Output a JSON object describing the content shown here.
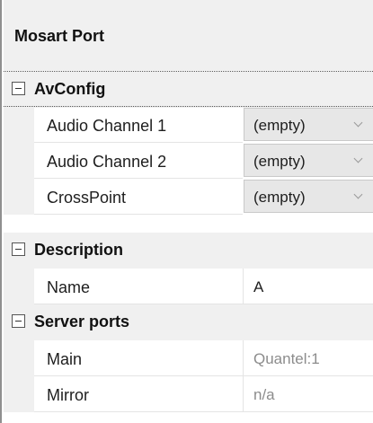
{
  "panel": {
    "title": "Mosart Port"
  },
  "categories": [
    {
      "label": "AvConfig",
      "rows": [
        {
          "name": "Audio Channel 1",
          "value": "(empty)"
        },
        {
          "name": "Audio Channel 2",
          "value": "(empty)"
        },
        {
          "name": "CrossPoint",
          "value": "(empty)"
        }
      ]
    },
    {
      "label": "Description",
      "rows": [
        {
          "name": "Name",
          "value": "A"
        }
      ]
    },
    {
      "label": "Server ports",
      "rows": [
        {
          "name": "Main",
          "value": "Quantel:1"
        },
        {
          "name": "Mirror",
          "value": "n/a"
        }
      ]
    }
  ],
  "icons": {
    "collapse": "minus-box-icon",
    "dropdown": "chevron-down-icon"
  },
  "colors": {
    "category_background": "#f0f0f0",
    "readonly_text": "#8c8c8c",
    "combo_background": "#e7e7e7"
  }
}
